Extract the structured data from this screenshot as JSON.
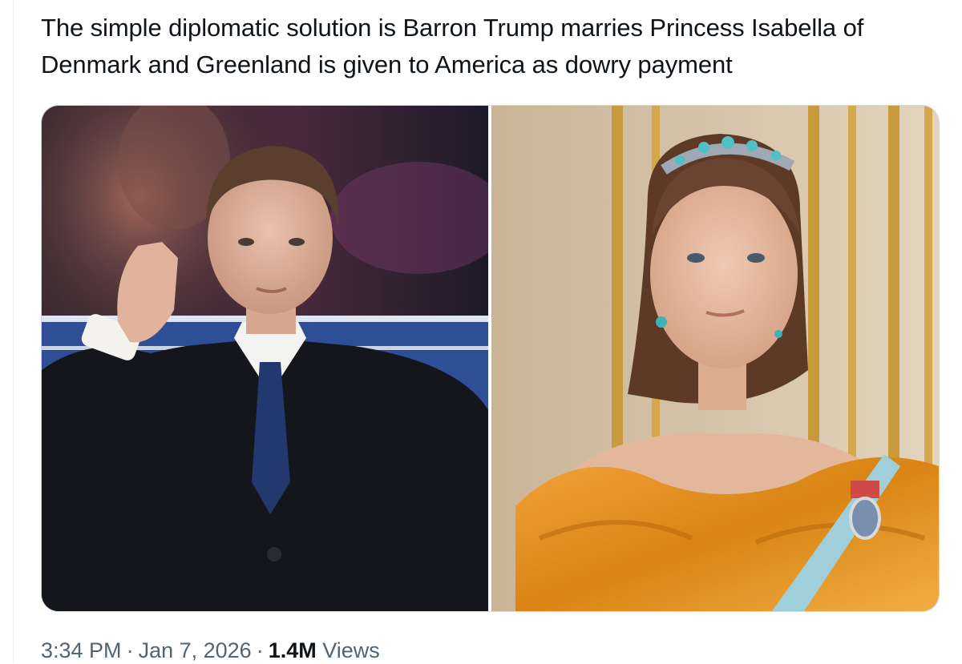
{
  "tweet": {
    "text": "The simple diplomatic solution is Barron Trump marries Princess Isabella of Denmark and Greenland is given to America as dowry payment"
  },
  "media": {
    "photos": [
      {
        "subject": "young man in dark coat and blue tie raising hand to ear"
      },
      {
        "subject": "young woman in orange gown with tiara and blue sash"
      }
    ]
  },
  "meta": {
    "time": "3:34 PM",
    "separator": "·",
    "date": "Jan 7, 2026",
    "views_count": "1.4M",
    "views_label": "Views"
  },
  "colors": {
    "text_primary": "#0f1419",
    "text_secondary": "#536471",
    "border": "#cfd9de"
  }
}
